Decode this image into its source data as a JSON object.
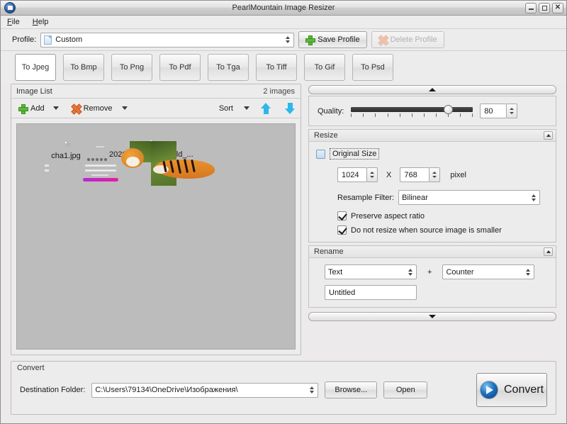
{
  "window": {
    "title": "PearlMountain Image Resizer",
    "app_icon": "app-icon",
    "minimize": "–",
    "maximize": "□",
    "close": "×"
  },
  "menubar": {
    "items": [
      {
        "label": "File",
        "accel": "F"
      },
      {
        "label": "Help",
        "accel": "H"
      }
    ]
  },
  "profile_bar": {
    "label": "Profile:",
    "value": "Custom",
    "save_label": "Save Profile",
    "delete_label": "Delete Profile",
    "delete_enabled": false
  },
  "format_tabs": {
    "active": "To Jpeg",
    "items": [
      {
        "label": "To Jpeg"
      },
      {
        "label": "To Bmp"
      },
      {
        "label": "To Png"
      },
      {
        "label": "To Pdf"
      },
      {
        "label": "To Tga"
      },
      {
        "label": "To Tiff"
      },
      {
        "label": "To Gif"
      },
      {
        "label": "To Psd"
      }
    ]
  },
  "image_list": {
    "title": "Image List",
    "count_text": "2 images",
    "add_label": "Add",
    "remove_label": "Remove",
    "sort_label": "Sort",
    "move_up_icon": "arrow-up-icon",
    "move_down_icon": "arrow-down-icon",
    "items": [
      {
        "name": "cha1.jpg",
        "kind": "form-screenshot"
      },
      {
        "name": "2020Animals___Wild_...",
        "kind": "tiger-photo"
      }
    ]
  },
  "quality": {
    "label": "Quality:",
    "value": "80",
    "min": 0,
    "max": 100,
    "tick_count": 11
  },
  "resize": {
    "title": "Resize",
    "original_size_label": "Original Size",
    "width": "1024",
    "height": "768",
    "separator": "X",
    "unit": "pixel",
    "resample_label": "Resample Filter:",
    "resample_value": "Bilinear",
    "preserve_aspect_label": "Preserve aspect ratio",
    "preserve_aspect_checked": true,
    "no_upscale_label": "Do not resize when source image is smaller",
    "no_upscale_checked": true
  },
  "rename": {
    "title": "Rename",
    "left_value": "Text",
    "plus": "+",
    "right_value": "Counter",
    "text_value": "Untitled"
  },
  "convert": {
    "title": "Convert",
    "dest_label": "Destination Folder:",
    "dest_value": "C:\\Users\\79134\\OneDrive\\Изображения\\",
    "browse_label": "Browse...",
    "open_label": "Open",
    "convert_label": "Convert"
  },
  "colors": {
    "window_bg": "#ececec",
    "list_bg": "#bcbcbc",
    "accent_blue": "#2fb7ea",
    "add_green": "#5db83a",
    "remove_orange": "#e8763a",
    "convert_blue": "#1c72c4"
  }
}
